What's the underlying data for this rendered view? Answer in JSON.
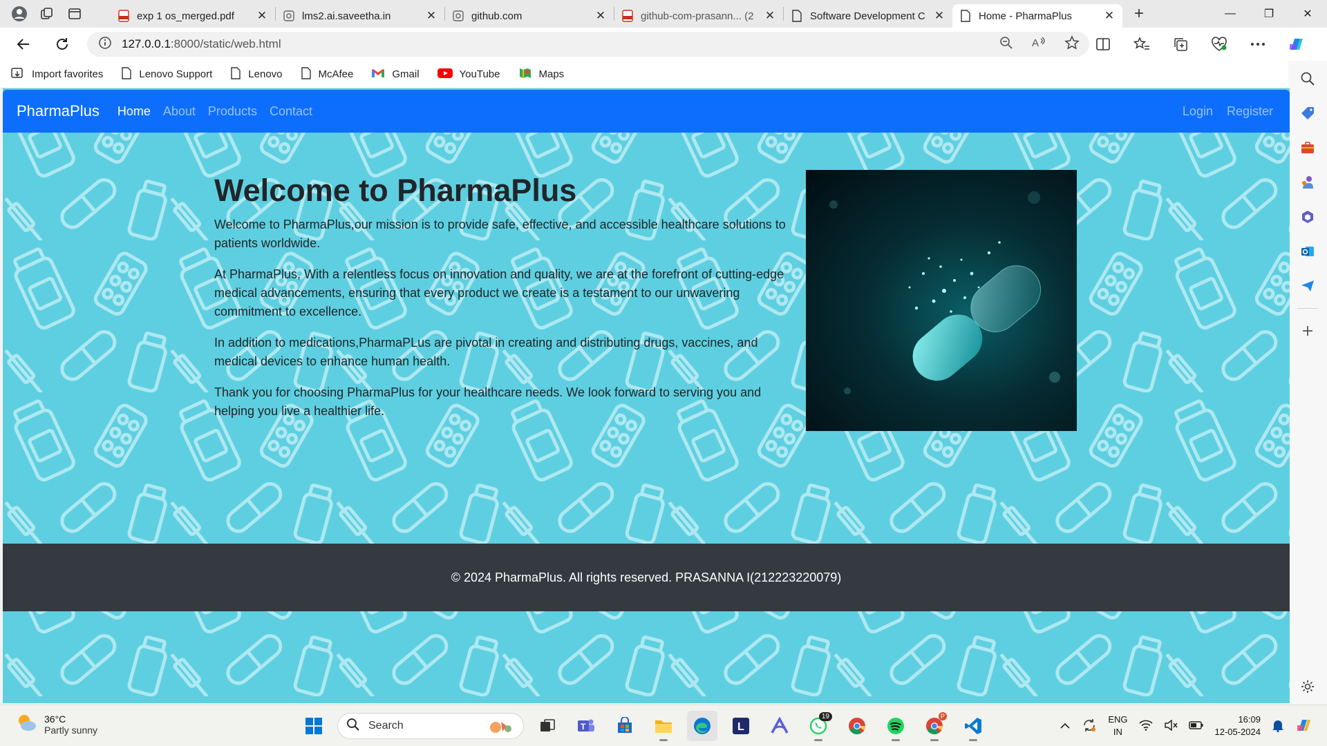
{
  "browser": {
    "tabs": [
      {
        "title": "exp 1 os_merged.pdf",
        "icon": "pdf-icon"
      },
      {
        "title": "lms2.ai.saveetha.in",
        "icon": "web-page-icon"
      },
      {
        "title": "github.com",
        "icon": "web-page-icon"
      },
      {
        "title": "github-com-prasann... (2",
        "icon": "pdf-icon"
      },
      {
        "title": "Software Development C",
        "icon": "page-icon"
      },
      {
        "title": "Home - PharmaPlus",
        "icon": "page-icon",
        "active": true
      }
    ],
    "url_host": "127.0.0.1",
    "url_rest": ":8000/static/web.html",
    "favorites": [
      {
        "label": "Import favorites",
        "icon": "import-icon"
      },
      {
        "label": "Lenovo Support",
        "icon": "page-icon"
      },
      {
        "label": "Lenovo",
        "icon": "page-icon"
      },
      {
        "label": "McAfee",
        "icon": "page-icon"
      },
      {
        "label": "Gmail",
        "icon": "gmail-icon"
      },
      {
        "label": "YouTube",
        "icon": "youtube-icon"
      },
      {
        "label": "Maps",
        "icon": "maps-icon"
      }
    ]
  },
  "site": {
    "brand": "PharmaPlus",
    "nav": [
      "Home",
      "About",
      "Products",
      "Contact"
    ],
    "auth": [
      "Login",
      "Register"
    ],
    "hero_title": "Welcome to PharmaPlus",
    "paragraphs": [
      "Welcome to PharmaPlus,our mission is to provide safe, effective, and accessible healthcare solutions to patients worldwide.",
      "At PharmaPlus, With a relentless focus on innovation and quality, we are at the forefront of cutting-edge medical advancements, ensuring that every product we create is a testament to our unwavering commitment to excellence.",
      "In addition to medications,PharmaPLus are pivotal in creating and distributing drugs, vaccines, and medical devices to enhance human health.",
      "Thank you for choosing PharmaPlus for your healthcare needs. We look forward to serving you and helping you live a healthier life."
    ],
    "footer": "© 2024 PharmaPlus. All rights reserved. PRASANNA I(212223220079)",
    "colors": {
      "navbar": "#0d6efd",
      "background": "#5ecfe0",
      "footer": "#343a40"
    }
  },
  "taskbar": {
    "weather_temp": "36°C",
    "weather_desc": "Partly sunny",
    "search_label": "Search",
    "whatsapp_badge": "19",
    "chrome_profile_badge": "P",
    "lang_line1": "ENG",
    "lang_line2": "IN",
    "time": "16:09",
    "date": "12-05-2024"
  }
}
